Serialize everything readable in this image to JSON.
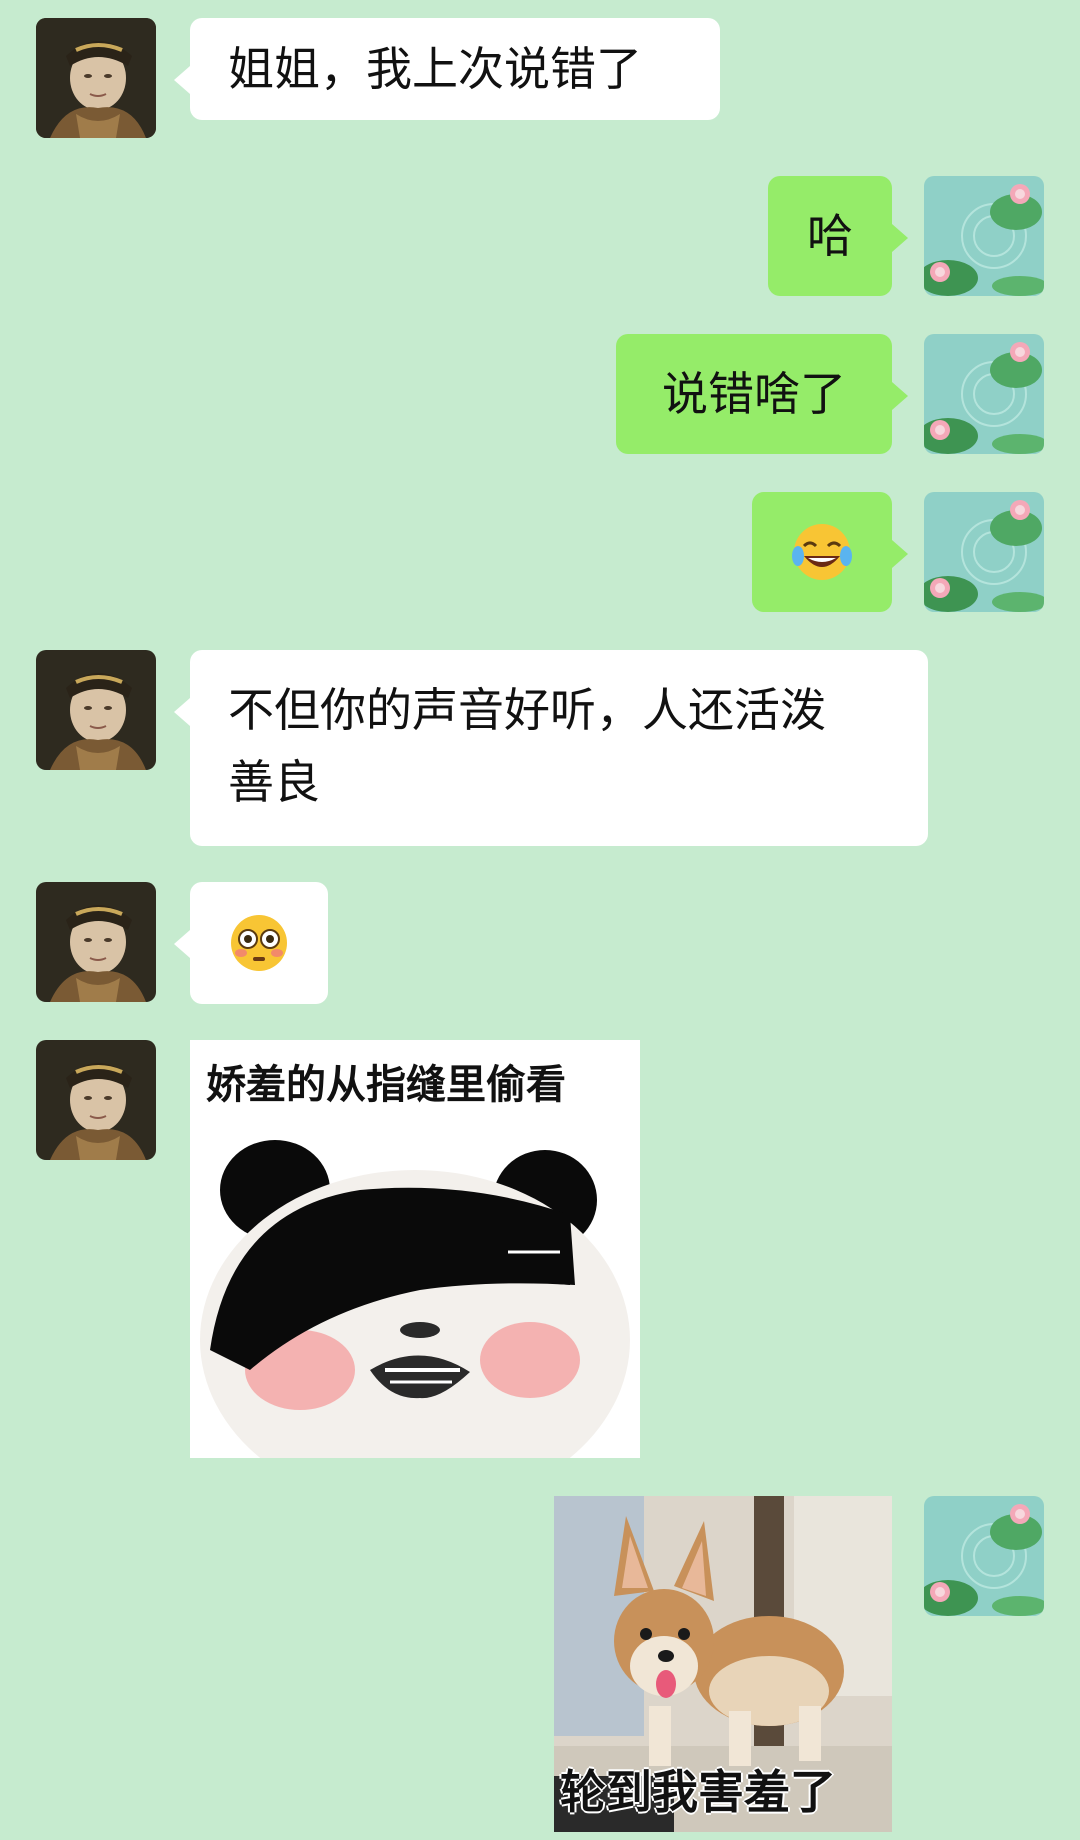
{
  "chat": {
    "background": "#c6ebcf",
    "incoming_bubble_color": "#ffffff",
    "outgoing_bubble_color": "#95ec69",
    "messages": [
      {
        "side": "left",
        "type": "text",
        "text": "姐姐，我上次说错了"
      },
      {
        "side": "right",
        "type": "text",
        "text": "哈"
      },
      {
        "side": "right",
        "type": "text",
        "text": "说错啥了"
      },
      {
        "side": "right",
        "type": "emoji",
        "icon": "tears-of-joy-emoji",
        "text": "😂"
      },
      {
        "side": "left",
        "type": "text",
        "line1": "不但你的声音好听，人还活泼",
        "line2": "善良"
      },
      {
        "side": "left",
        "type": "emoji",
        "icon": "flushed-face-emoji",
        "text": "😳"
      },
      {
        "side": "left",
        "type": "sticker",
        "icon": "panda-peeking-sticker",
        "caption": "娇羞的从指缝里偷看"
      },
      {
        "side": "right",
        "type": "sticker",
        "icon": "corgi-shy-sticker",
        "caption": "轮到我害羞了"
      }
    ]
  },
  "avatars": {
    "contact": "contact-avatar",
    "self": "lotus-pond-avatar"
  }
}
